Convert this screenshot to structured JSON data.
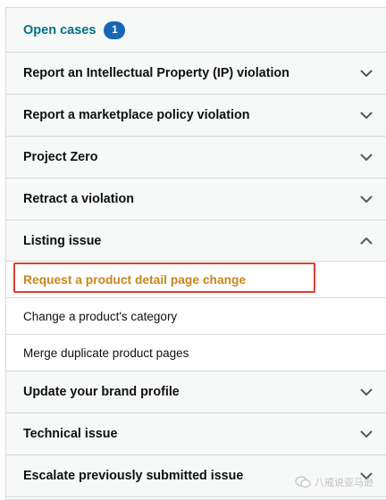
{
  "open_cases": {
    "label": "Open cases",
    "count": "1"
  },
  "rows_top": [
    {
      "label": "Report an Intellectual Property (IP) violation",
      "icon": "chevron-down-icon"
    },
    {
      "label": "Report a marketplace policy violation",
      "icon": "chevron-down-icon"
    },
    {
      "label": "Project Zero",
      "icon": "chevron-down-icon"
    },
    {
      "label": "Retract a violation",
      "icon": "chevron-down-icon"
    }
  ],
  "expanded_row": {
    "label": "Listing issue",
    "icon": "chevron-up-icon"
  },
  "sub_items": [
    {
      "label": "Request a product detail page change",
      "selected": true
    },
    {
      "label": "Change a product's category",
      "selected": false
    },
    {
      "label": "Merge duplicate product pages",
      "selected": false
    }
  ],
  "rows_bottom": [
    {
      "label": "Update your brand profile",
      "icon": "chevron-down-icon"
    },
    {
      "label": "Technical issue",
      "icon": "chevron-down-icon"
    },
    {
      "label": "Escalate previously submitted issue",
      "icon": "chevron-down-icon"
    }
  ],
  "colors": {
    "link": "#007185",
    "badge": "#1666b5",
    "selected_text": "#c7861c",
    "highlight_border": "#d9412f",
    "row_bg": "#f7f8f8",
    "divider": "#d5d9d9"
  },
  "watermark": {
    "text": "八戒说亚马逊"
  }
}
